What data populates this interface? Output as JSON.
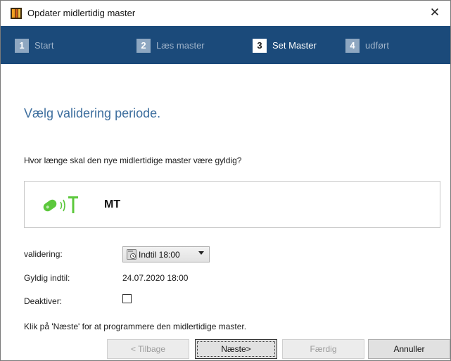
{
  "window": {
    "title": "Opdater midlertidig master",
    "close_glyph": "✕"
  },
  "steps": [
    {
      "number": "1",
      "label": "Start",
      "active": false
    },
    {
      "number": "2",
      "label": "Læs master",
      "active": false
    },
    {
      "number": "3",
      "label": "Set Master",
      "active": true
    },
    {
      "number": "4",
      "label": "udført",
      "active": false
    }
  ],
  "content": {
    "heading": "Vælg validering periode.",
    "question": "Hvor længe skal den nye midlertidige master være gyldig?",
    "device": {
      "icon": "rfid-tag-icon",
      "name": "MT"
    },
    "fields": {
      "validation_label": "validering:",
      "validation_value": "Indtil 18:00",
      "valid_until_label": "Gyldig indtil:",
      "valid_until_value": "24.07.2020 18:00",
      "deactivate_label": "Deaktiver:",
      "deactivate_checked": false
    },
    "hint": "Klik på 'Næste' for at programmere den midlertidige master."
  },
  "buttons": {
    "back": "< Tilbage",
    "next": "Næste>",
    "finish": "Færdig",
    "cancel": "Annuller"
  },
  "colors": {
    "stepbar": "#1b4a7a",
    "heading": "#3d6e9e",
    "device_icon": "#5cc83c"
  }
}
